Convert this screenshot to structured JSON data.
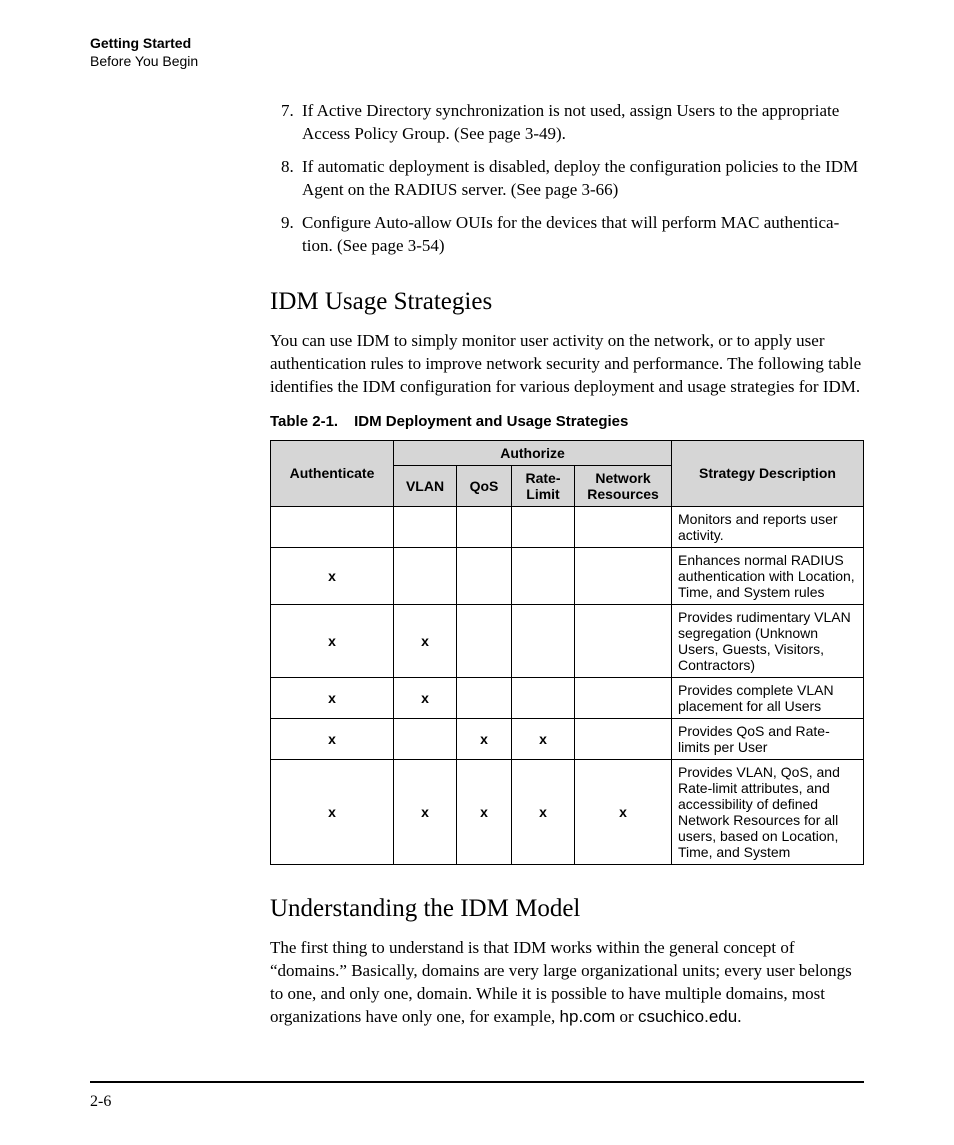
{
  "header": {
    "chapter": "Getting Started",
    "section": "Before You Begin"
  },
  "steps": {
    "start": 7,
    "items": [
      "If Active Directory synchronization is not used, assign Users to the appropriate Access Policy Group. (See page 3-49).",
      "If automatic deployment is disabled, deploy the configuration policies to the IDM Agent on the RADIUS server. (See page 3-66)",
      "Configure Auto-allow OUIs for the devices that will perform MAC authentica­tion. (See page 3-54)"
    ]
  },
  "section1": {
    "title": "IDM Usage Strategies",
    "intro": "You can use IDM to simply monitor user activity on the network, or to apply user authentication rules to improve network security and performance. The following table identifies the IDM configuration for various deployment and usage strategies for IDM."
  },
  "table": {
    "caption_num": "Table 2-1.",
    "caption_text": "IDM Deployment and Usage Strategies",
    "head": {
      "authenticate": "Authenticate",
      "authorize": "Authorize",
      "vlan": "VLAN",
      "qos": "QoS",
      "rate": "Rate-Limit",
      "net": "Network Resources",
      "desc": "Strategy Description"
    },
    "rows": [
      {
        "auth": "",
        "vlan": "",
        "qos": "",
        "rate": "",
        "net": "",
        "desc": "Monitors and reports user activity."
      },
      {
        "auth": "x",
        "vlan": "",
        "qos": "",
        "rate": "",
        "net": "",
        "desc": "Enhances normal RADIUS authentication with Location, Time, and System rules"
      },
      {
        "auth": "x",
        "vlan": "x",
        "qos": "",
        "rate": "",
        "net": "",
        "desc": "Provides rudimentary VLAN segregation (Unknown Users, Guests, Visitors, Contractors)"
      },
      {
        "auth": "x",
        "vlan": "x",
        "qos": "",
        "rate": "",
        "net": "",
        "desc": "Provides complete VLAN placement for all Users"
      },
      {
        "auth": "x",
        "vlan": "",
        "qos": "x",
        "rate": "x",
        "net": "",
        "desc": "Provides QoS and Rate-limits per User"
      },
      {
        "auth": "x",
        "vlan": "x",
        "qos": "x",
        "rate": "x",
        "net": "x",
        "desc": "Provides VLAN, QoS, and Rate-limit attributes, and accessibility of defined Network Resources for all users, based on Location, Time, and System"
      }
    ]
  },
  "section2": {
    "title": "Understanding the IDM Model",
    "para_prefix": "The first thing to understand is that IDM works within the general concept of “domains.” Basically, domains are very large organizational units; every user belongs to one, and only one, domain. While it is possible to have multiple domains, most organizations have only one, for example, ",
    "example1": "hp.com",
    "joiner": " or ",
    "example2": "csuchico.edu",
    "suffix": "."
  },
  "footer": {
    "page": "2-6"
  }
}
